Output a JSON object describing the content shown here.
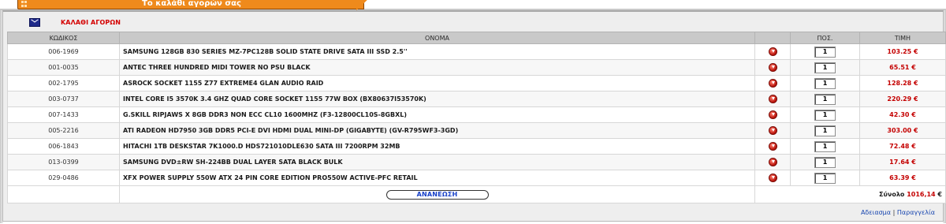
{
  "tab": {
    "title": "Το καλάθι αγορών σας"
  },
  "cart": {
    "title": "ΚΑΛΑΘΙ ΑΓΟΡΩΝ",
    "columns": {
      "code": "ΚΩΔΙΚΟΣ",
      "name": "ΟΝΟΜΑ",
      "qty": "ΠΟΣ.",
      "price": "ΤΙΜΗ"
    },
    "rows": [
      {
        "code": "006-1969",
        "name": "SAMSUNG 128GB 830 SERIES MZ-7PC128B SOLID STATE DRIVE SATA III SSD 2.5''",
        "qty": "1",
        "price": "103.25 €"
      },
      {
        "code": "001-0035",
        "name": "ANTEC THREE HUNDRED MIDI TOWER NO PSU BLACK",
        "qty": "1",
        "price": "65.51 €"
      },
      {
        "code": "002-1795",
        "name": "ASROCK SOCKET 1155 Z77 EXTREME4 GLAN AUDIO RAID",
        "qty": "1",
        "price": "128.28 €"
      },
      {
        "code": "003-0737",
        "name": "INTEL CORE I5 3570K 3.4 GHZ QUAD CORE SOCKET 1155 77W BOX (BX80637I53570K)",
        "qty": "1",
        "price": "220.29 €"
      },
      {
        "code": "007-1433",
        "name": "G.SKILL RIPJAWS X 8GB DDR3 NON ECC CL10 1600MHZ (F3-12800CL10S-8GBXL)",
        "qty": "1",
        "price": "42.30 €"
      },
      {
        "code": "005-2216",
        "name": "ATI RADEON HD7950 3GB DDR5 PCI-E DVI HDMI DUAL MINI-DP (GIGABYTE) (GV-R795WF3-3GD)",
        "qty": "1",
        "price": "303.00 €"
      },
      {
        "code": "006-1843",
        "name": "HITACHI 1TB DESKSTAR 7K1000.D HDS721010DLE630 SATA III 7200RPM 32MB",
        "qty": "1",
        "price": "72.48 €"
      },
      {
        "code": "013-0399",
        "name": "SAMSUNG DVD±RW SH-224BB DUAL LAYER SATA BLACK BULK",
        "qty": "1",
        "price": "17.64 €"
      },
      {
        "code": "029-0486",
        "name": "XFX POWER SUPPLY 550W ATX 24 PIN CORE EDITION PRO550W ACTIVE-PFC RETAIL",
        "qty": "1",
        "price": "63.39 €"
      }
    ],
    "refresh_label": "ΑΝΑΝΕΩΣΗ",
    "total_label": "Σύνολο",
    "total_value": "1016,14",
    "total_currency": "€"
  },
  "links": {
    "empty": "Αδειασμα",
    "separator": "|",
    "order": "Παραγγελία"
  },
  "colors": {
    "tab": "#ef8a1c",
    "price": "#c40000",
    "link": "#1846b0"
  }
}
